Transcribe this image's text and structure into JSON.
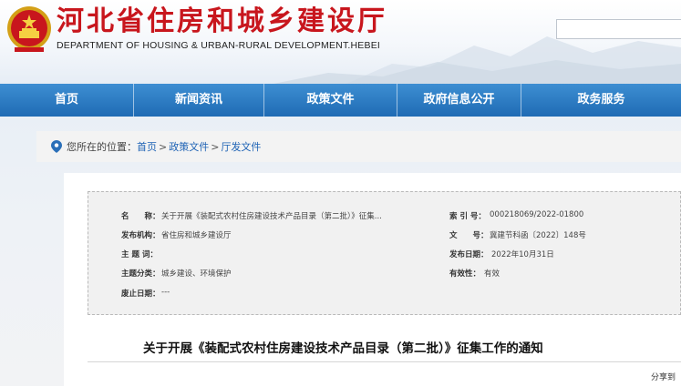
{
  "header": {
    "title": "河北省住房和城乡建设厅",
    "subtitle": "DEPARTMENT OF HOUSING & URBAN-RURAL DEVELOPMENT.HEBEI",
    "search_placeholder": "",
    "colors": {
      "title": "#c8161d",
      "nav": "#2a7bc4"
    }
  },
  "nav": {
    "items": [
      {
        "label": "首页"
      },
      {
        "label": "新闻资讯"
      },
      {
        "label": "政策文件"
      },
      {
        "label": "政府信息公开"
      },
      {
        "label": "政务服务"
      }
    ]
  },
  "breadcrumb": {
    "prefix": "您所在的位置：",
    "items": [
      "首页",
      "政策文件",
      "厅发文件"
    ],
    "separator": ">"
  },
  "meta": {
    "name_label": "名　　称：",
    "name_value": "关于开展《装配式农村住房建设技术产品目录（第二批）》征集...",
    "index_label": "索 引 号：",
    "index_value": "000218069/2022-01800",
    "issuer_label": "发布机构：",
    "issuer_value": "省住房和城乡建设厅",
    "docno_label": "文　　号：",
    "docno_value": "冀建节科函〔2022〕148号",
    "subject_label": "主 题 词：",
    "subject_value": "",
    "date_label": "发布日期：",
    "date_value": "2022年10月31日",
    "category_label": "主题分类：",
    "category_value": "城乡建设、环境保护",
    "validity_label": "有效性：",
    "validity_value": "有效",
    "repeal_label": "废止日期：",
    "repeal_value": "---"
  },
  "document": {
    "title": "关于开展《装配式农村住房建设技术产品目录（第二批）》征集工作的通知"
  },
  "share": {
    "label": "分享到"
  }
}
